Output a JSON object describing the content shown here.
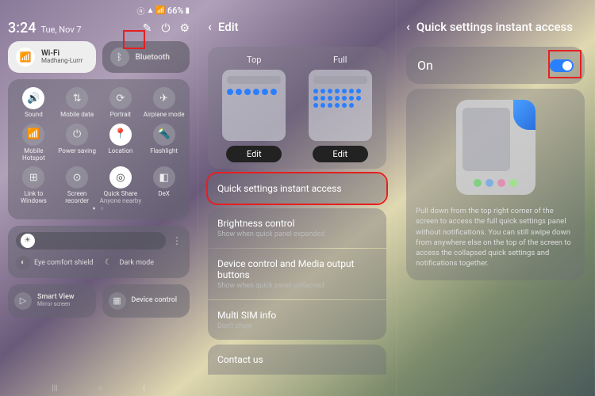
{
  "statusbar": {
    "battery": "66%",
    "signal_icons": "⋮ 📶 ⚡"
  },
  "s1": {
    "time": "3:24",
    "date": "Tue, Nov 7",
    "actions": {
      "edit": "✎",
      "power": "⏻",
      "settings": "⚙"
    },
    "wifi": {
      "title": "Wi-Fi",
      "sub": "Madhang-Lurrr"
    },
    "bt": {
      "title": "Bluetooth"
    },
    "tiles": [
      {
        "label": "Sound",
        "on": true,
        "icon": "🔊"
      },
      {
        "label": "Mobile data",
        "on": false,
        "icon": "⇅"
      },
      {
        "label": "Portrait",
        "on": false,
        "icon": "⟳"
      },
      {
        "label": "Airplane mode",
        "on": false,
        "icon": "✈"
      },
      {
        "label": "Mobile Hotspot",
        "on": false,
        "icon": "📶"
      },
      {
        "label": "Power saving",
        "on": false,
        "icon": "⏻"
      },
      {
        "label": "Location",
        "on": true,
        "icon": "📍"
      },
      {
        "label": "Flashlight",
        "on": false,
        "icon": "🔦"
      },
      {
        "label": "Link to Windows",
        "on": false,
        "icon": "⊞"
      },
      {
        "label": "Screen recorder",
        "on": false,
        "icon": "⊙"
      },
      {
        "label": "Quick Share",
        "sub": "Anyone nearby",
        "on": true,
        "icon": "◎"
      },
      {
        "label": "DeX",
        "on": false,
        "icon": "◧"
      }
    ],
    "eye": "Eye comfort shield",
    "dark": "Dark mode",
    "smartview": {
      "title": "Smart View",
      "sub": "Mirror screen"
    },
    "devicecontrol": {
      "title": "Device control"
    }
  },
  "s2": {
    "title": "Edit",
    "top_label": "Top",
    "full_label": "Full",
    "edit_btn": "Edit",
    "opt_qsia": "Quick settings instant access",
    "opt_bright": {
      "t": "Brightness control",
      "s": "Show when quick panel expanded"
    },
    "opt_devmed": {
      "t": "Device control and Media output buttons",
      "s": "Show when quick panel collapsed"
    },
    "opt_sim": {
      "t": "Multi SIM info",
      "s": "Don't show"
    },
    "opt_contact": "Contact us"
  },
  "s3": {
    "title": "Quick settings instant access",
    "on_label": "On",
    "pv_colors": [
      "#7fd07f",
      "#7fb0e0",
      "#e090b0",
      "#a0e090"
    ],
    "desc": "Pull down from the top right corner of the screen to access the full quick settings panel without notifications. You can still swipe down from anywhere else on the top of the screen to access the collapsed quick settings and notifications together."
  }
}
